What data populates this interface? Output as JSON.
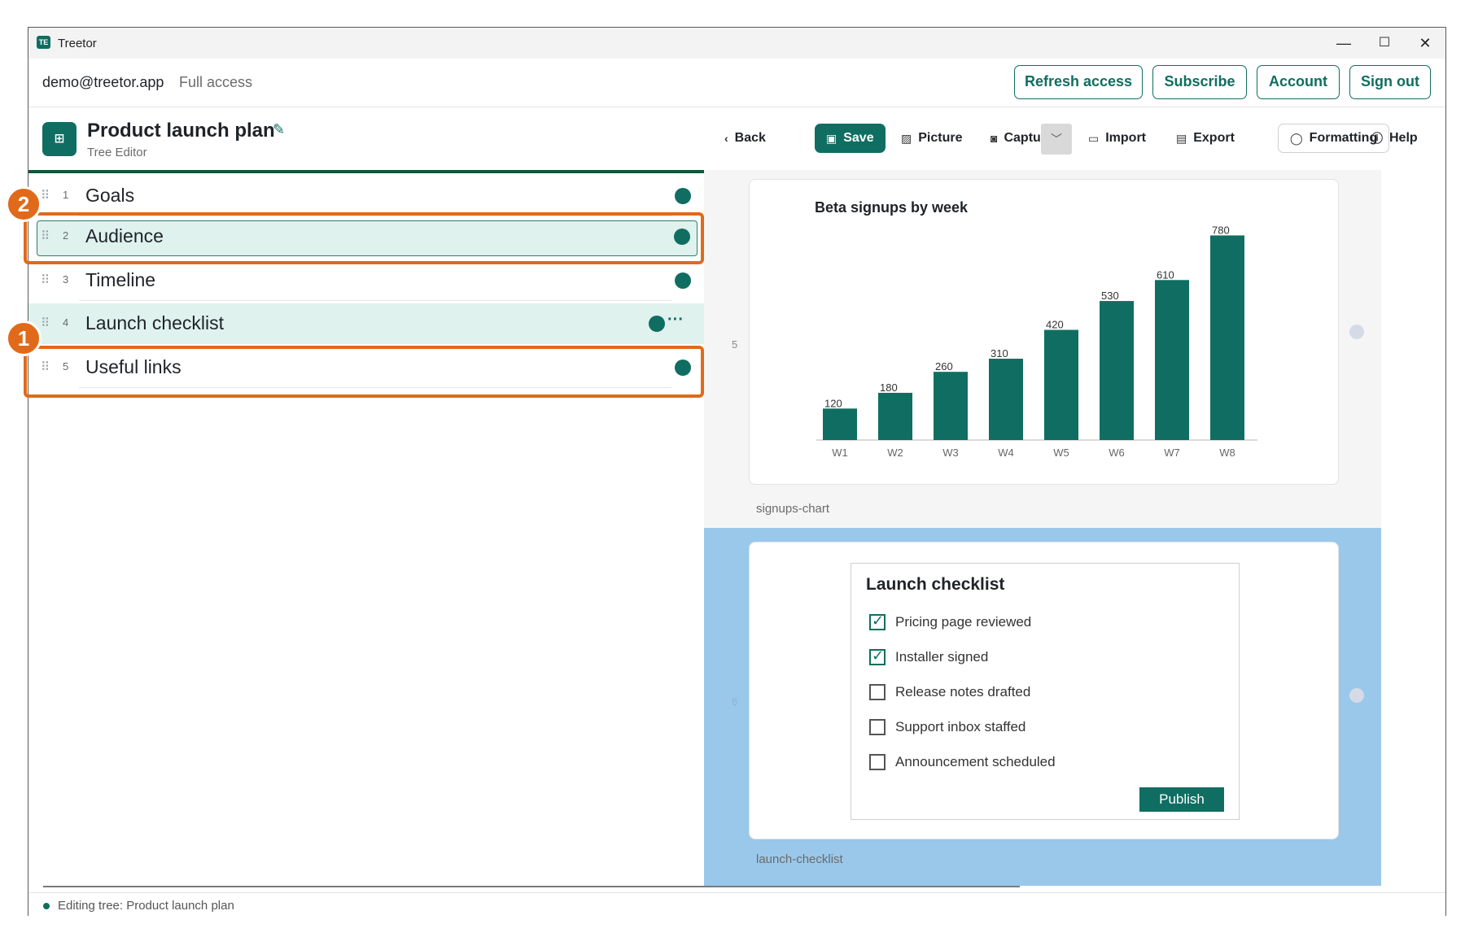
{
  "window": {
    "title": "Treetor",
    "minimize": "—",
    "maximize": "☐",
    "close": "✕"
  },
  "account": {
    "email": "demo@treetor.app",
    "access": "Full access",
    "buttons": {
      "refresh": "Refresh access",
      "subscribe": "Subscribe",
      "account": "Account",
      "signout": "Sign out"
    }
  },
  "document": {
    "title": "Product launch plan",
    "subtitle": "Tree Editor"
  },
  "toolbar": {
    "back": "Back",
    "save": "Save",
    "picture": "Picture",
    "capture": "Capture",
    "import": "Import",
    "export": "Export",
    "formatting": "Formatting",
    "help": "Help"
  },
  "tree": {
    "rows": [
      {
        "num": "1",
        "label": "Goals"
      },
      {
        "num": "2",
        "label": "Audience"
      },
      {
        "num": "3",
        "label": "Timeline"
      },
      {
        "num": "4",
        "label": "Launch checklist"
      },
      {
        "num": "5",
        "label": "Useful links"
      }
    ],
    "more": "···"
  },
  "callouts": {
    "first": "1",
    "second": "2"
  },
  "preview": {
    "chart_card_marker": "5",
    "chart_caption": "signups-chart",
    "checklist_card_marker": "6",
    "checklist_caption": "launch-checklist",
    "checklist": {
      "title": "Launch checklist",
      "items": [
        {
          "label": "Pricing page reviewed",
          "checked": true
        },
        {
          "label": "Installer signed",
          "checked": true
        },
        {
          "label": "Release notes drafted",
          "checked": false
        },
        {
          "label": "Support inbox staffed",
          "checked": false
        },
        {
          "label": "Announcement scheduled",
          "checked": false
        }
      ],
      "button": "Publish"
    }
  },
  "chart_data": {
    "type": "bar",
    "title": "Beta signups by week",
    "categories": [
      "W1",
      "W2",
      "W3",
      "W4",
      "W5",
      "W6",
      "W7",
      "W8"
    ],
    "values": [
      120,
      180,
      260,
      310,
      420,
      530,
      610,
      780
    ],
    "ylim": [
      0,
      800
    ],
    "color": "#0f6e61",
    "data_labels": true,
    "grid": false
  },
  "status": {
    "text": "Editing tree: Product launch plan"
  },
  "colors": {
    "accent": "#0f6e61",
    "callout": "#e06a1a",
    "highlight": "#9ac8ea"
  }
}
